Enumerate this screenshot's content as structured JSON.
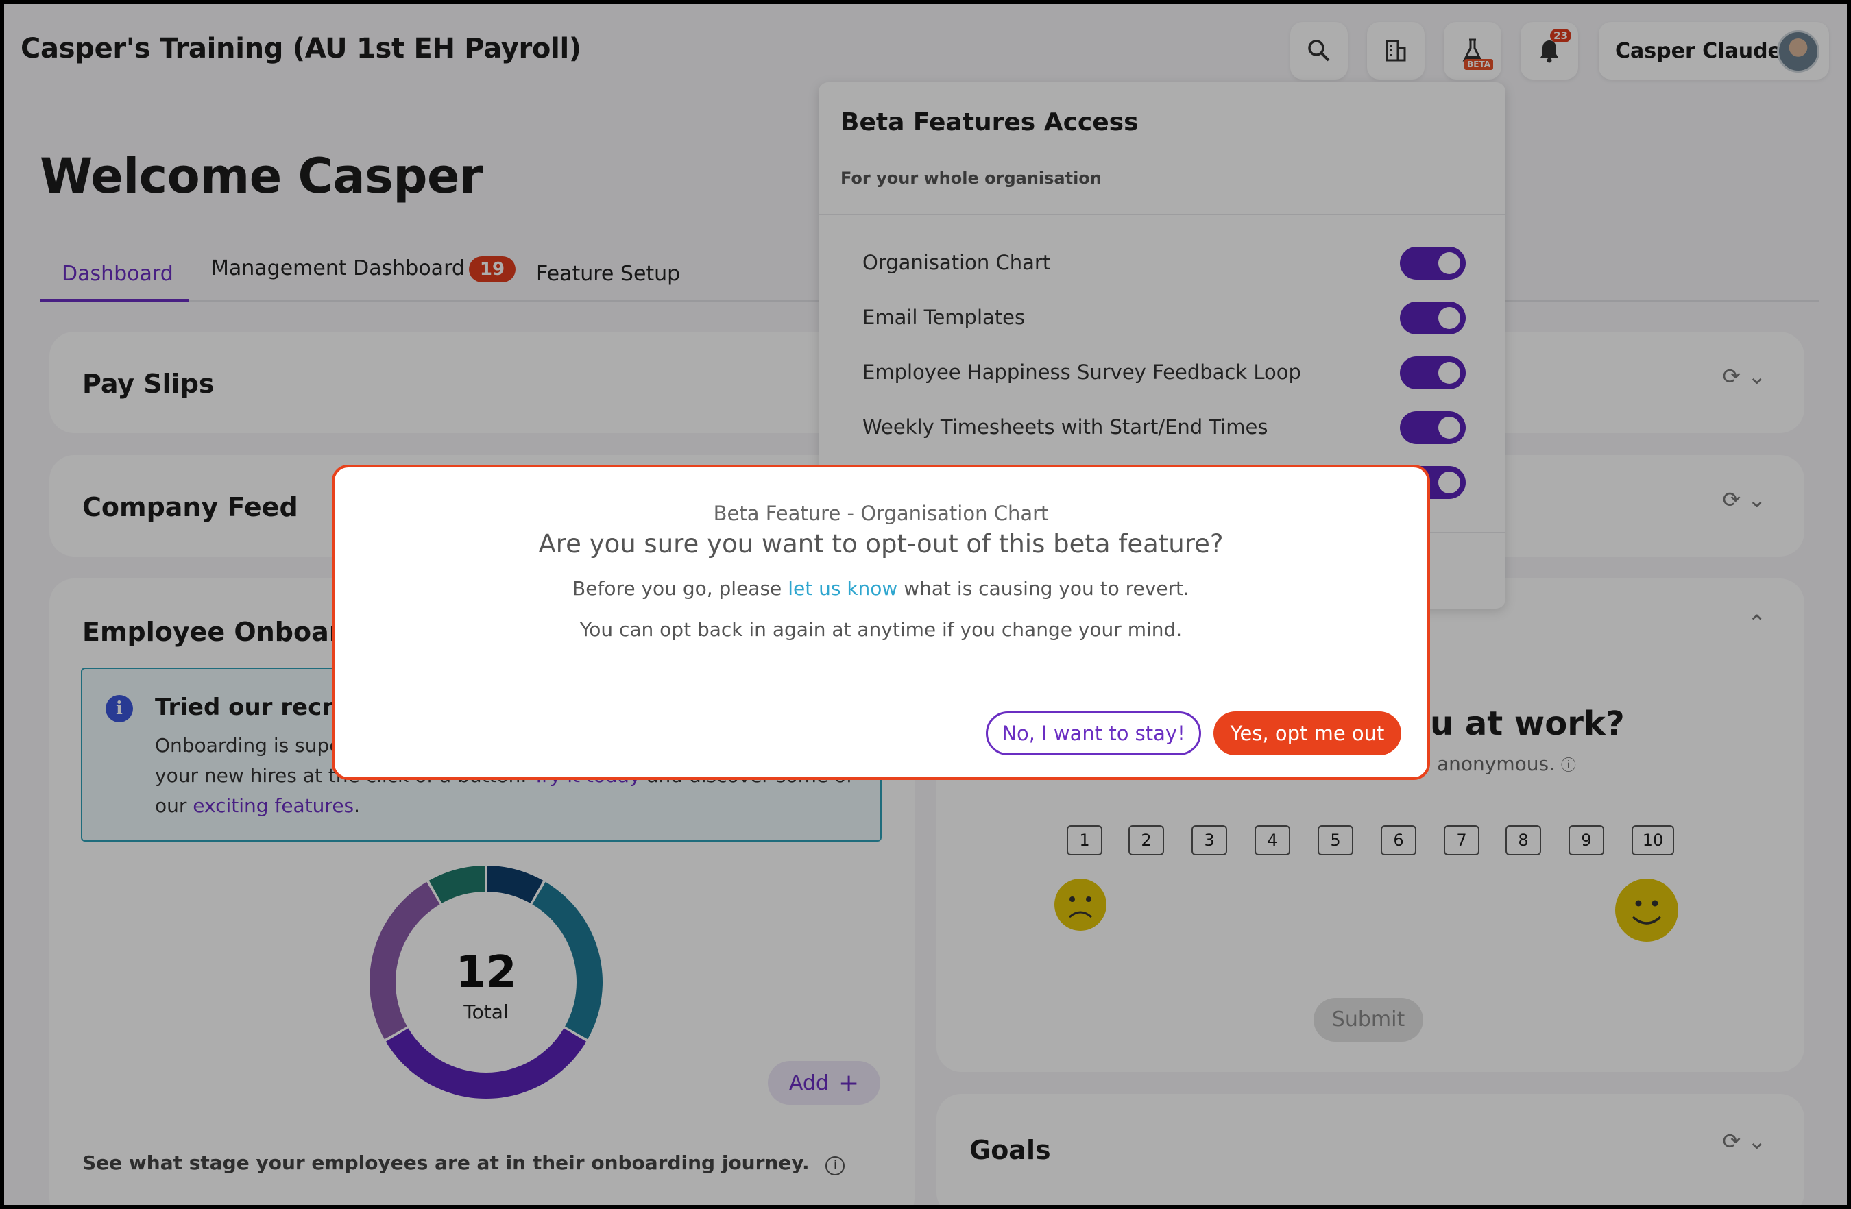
{
  "header": {
    "app_title": "Casper's Training (AU 1st EH Payroll)",
    "icons": [
      "search-icon",
      "building-icon",
      "flask-beta-icon",
      "bell-icon"
    ],
    "beta_tag": "BETA",
    "notification_count": "23",
    "user_name": "Casper Claude"
  },
  "welcome": "Welcome Casper",
  "tabs": [
    {
      "label": "Dashboard"
    },
    {
      "label": "Management Dashboard",
      "badge": "19"
    },
    {
      "label": "Feature Setup"
    }
  ],
  "cards": {
    "pay_slips": "Pay Slips",
    "company_feed": "Company Feed",
    "onboarding": {
      "title": "Employee Onboardi",
      "info_title": "Tried our recruit",
      "info_line1": "Onboarding is supe",
      "info_line2_a": "your new hires at th",
      "info_line2_b": "e click of a button.",
      "info_line2_link": "Try it today",
      "info_line2_c": "and discover some of",
      "info_line3_a": "our",
      "info_line3_link": "exciting features",
      "info_line3_b": ".",
      "donut_total": "12",
      "donut_label": "Total",
      "add_label": "Add",
      "footer": "See what stage your employees are at in their onboarding journey."
    },
    "survey": {
      "title_fragment": "u at work?",
      "subtitle_fragment": "anonymous.",
      "scale": [
        "1",
        "2",
        "3",
        "4",
        "5",
        "6",
        "7",
        "8",
        "9",
        "10"
      ],
      "submit": "Submit"
    },
    "goals": "Goals"
  },
  "beta_panel": {
    "title": "Beta Features Access",
    "subtitle": "For your whole organisation",
    "features": [
      {
        "label": "Organisation Chart",
        "enabled": true
      },
      {
        "label": "Email Templates",
        "enabled": true
      },
      {
        "label": "Employee Happiness Survey Feedback Loop",
        "enabled": true
      },
      {
        "label": "Weekly Timesheets with Start/End Times",
        "enabled": true
      }
    ]
  },
  "modal": {
    "subtitle": "Beta Feature - Organisation Chart",
    "question": "Are you sure you want to opt-out of this beta feature?",
    "text1_a": "Before you go, please",
    "text1_link": "let us know",
    "text1_b": "what is causing you to revert.",
    "text2": "You can opt back in again at anytime if you change your mind.",
    "stay_button": "No, I want to stay!",
    "opt_out_button": "Yes, opt me out"
  },
  "colors": {
    "accent": "#6a2ec2",
    "danger": "#e8421c",
    "info": "#2fa6cf"
  },
  "chart_data": {
    "type": "pie",
    "center_value": 12,
    "center_label": "Total",
    "values": [
      1,
      3,
      4,
      3,
      1
    ],
    "colors": [
      "#0e3d6b",
      "#1e7a96",
      "#5a23b8",
      "#8a5aa8",
      "#1f7a6a"
    ]
  }
}
